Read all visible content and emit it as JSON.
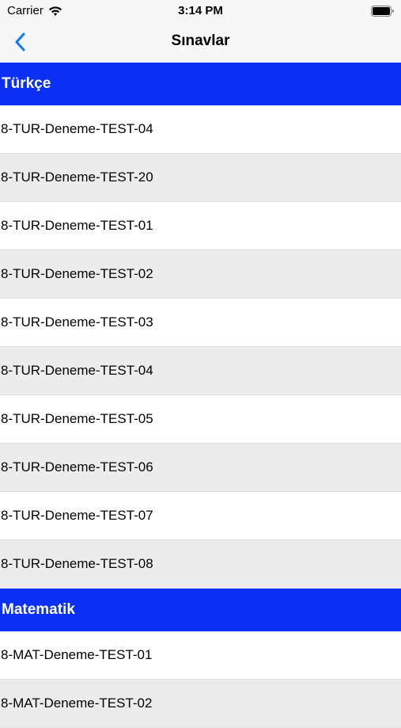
{
  "status_bar": {
    "carrier": "Carrier",
    "time": "3:14 PM"
  },
  "nav": {
    "title": "Sınavlar",
    "back_icon": "chevron-left-icon"
  },
  "colors": {
    "section_header_bg": "#0a30f5",
    "alt_row_bg": "#ececec",
    "accent": "#0a7aff"
  },
  "sections": [
    {
      "title": "Türkçe",
      "items": [
        "8-TUR-Deneme-TEST-04",
        "8-TUR-Deneme-TEST-20",
        "8-TUR-Deneme-TEST-01",
        "8-TUR-Deneme-TEST-02",
        "8-TUR-Deneme-TEST-03",
        "8-TUR-Deneme-TEST-04",
        "8-TUR-Deneme-TEST-05",
        "8-TUR-Deneme-TEST-06",
        "8-TUR-Deneme-TEST-07",
        "8-TUR-Deneme-TEST-08"
      ]
    },
    {
      "title": "Matematik",
      "items": [
        "8-MAT-Deneme-TEST-01",
        "8-MAT-Deneme-TEST-02"
      ]
    }
  ]
}
